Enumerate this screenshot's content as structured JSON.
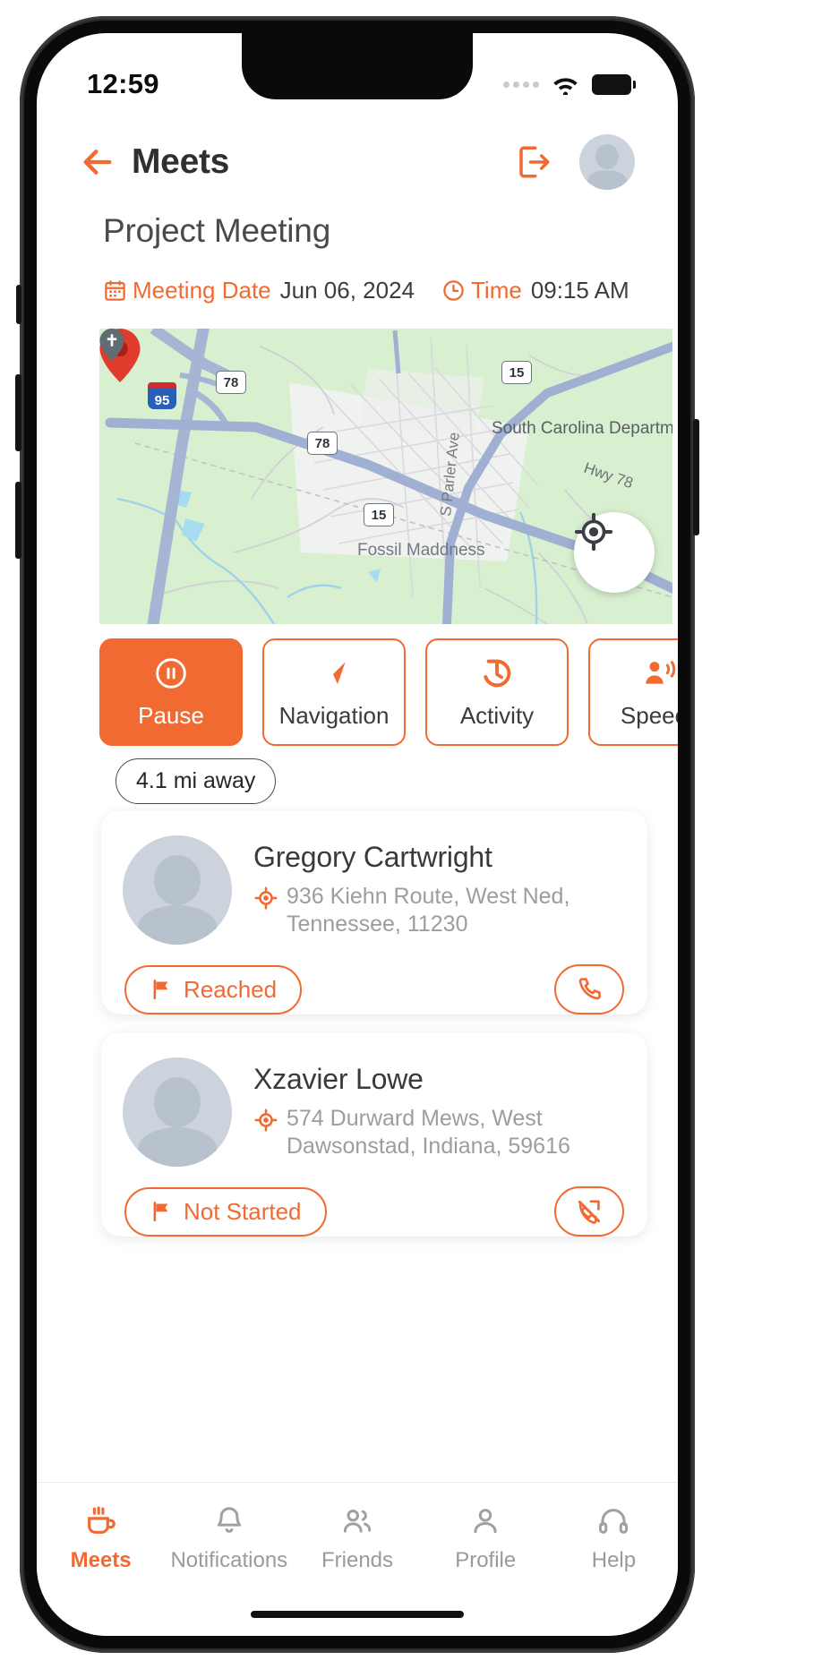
{
  "status_bar": {
    "time": "12:59",
    "signal_icon": "signal-dots-icon",
    "wifi_icon": "wifi-icon",
    "battery_icon": "battery-full-icon"
  },
  "header": {
    "back_icon": "back-arrow-icon",
    "title": "Meets",
    "logout_icon": "logout-icon",
    "avatar_icon": "user-avatar"
  },
  "meeting": {
    "title": "Project Meeting",
    "date_icon": "calendar-icon",
    "date_label": "Meeting Date",
    "date_value": "Jun 06, 2024",
    "time_icon": "clock-icon",
    "time_label": "Time",
    "time_value": "09:15 AM"
  },
  "map": {
    "pin_icon": "map-marker-icon",
    "locate_icon": "my-location-icon",
    "pois": [
      {
        "name": "South Carolina Department of Motor...",
        "icon": "government-building-icon"
      },
      {
        "name": "Fossil Maddness",
        "icon": "place-marker-icon"
      }
    ],
    "road_shields": [
      {
        "label": "78"
      },
      {
        "label": "78"
      },
      {
        "label": "15"
      },
      {
        "label": "15"
      }
    ],
    "interstate": "95",
    "street_labels": [
      "S Parler Ave",
      "Hwy 78"
    ]
  },
  "actions": [
    {
      "label": "Pause",
      "icon": "pause-circle-icon",
      "active": true
    },
    {
      "label": "Navigation",
      "icon": "navigation-arrow-icon",
      "active": false
    },
    {
      "label": "Activity",
      "icon": "history-clock-icon",
      "active": false
    },
    {
      "label": "Speech",
      "icon": "speech-person-icon",
      "active": false
    }
  ],
  "distance_badge": "4.1 mi away",
  "contacts": [
    {
      "name": "Gregory Cartwright",
      "address": "936 Kiehn Route, West Ned, Tennessee, 11230",
      "address_icon": "location-target-icon",
      "status": "Reached",
      "status_icon": "flag-icon",
      "call_icon": "phone-icon",
      "avatar_icon": "user-avatar"
    },
    {
      "name": "Xzavier Lowe",
      "address": "574 Durward Mews, West Dawsonstad, Indiana, 59616",
      "address_icon": "location-target-icon",
      "status": "Not Started",
      "status_icon": "flag-icon",
      "call_icon": "phone-missed-icon",
      "avatar_icon": "user-avatar"
    }
  ],
  "bottom_nav": [
    {
      "label": "Meets",
      "icon": "coffee-cup-icon",
      "active": true
    },
    {
      "label": "Notifications",
      "icon": "bell-icon",
      "active": false
    },
    {
      "label": "Friends",
      "icon": "people-icon",
      "active": false
    },
    {
      "label": "Profile",
      "icon": "person-icon",
      "active": false
    },
    {
      "label": "Help",
      "icon": "headset-icon",
      "active": false
    }
  ],
  "colors": {
    "accent": "#f06a32",
    "text_dark": "#3a3a3a",
    "text_muted": "#9d9d9d",
    "map_land": "#d9f0d0"
  }
}
